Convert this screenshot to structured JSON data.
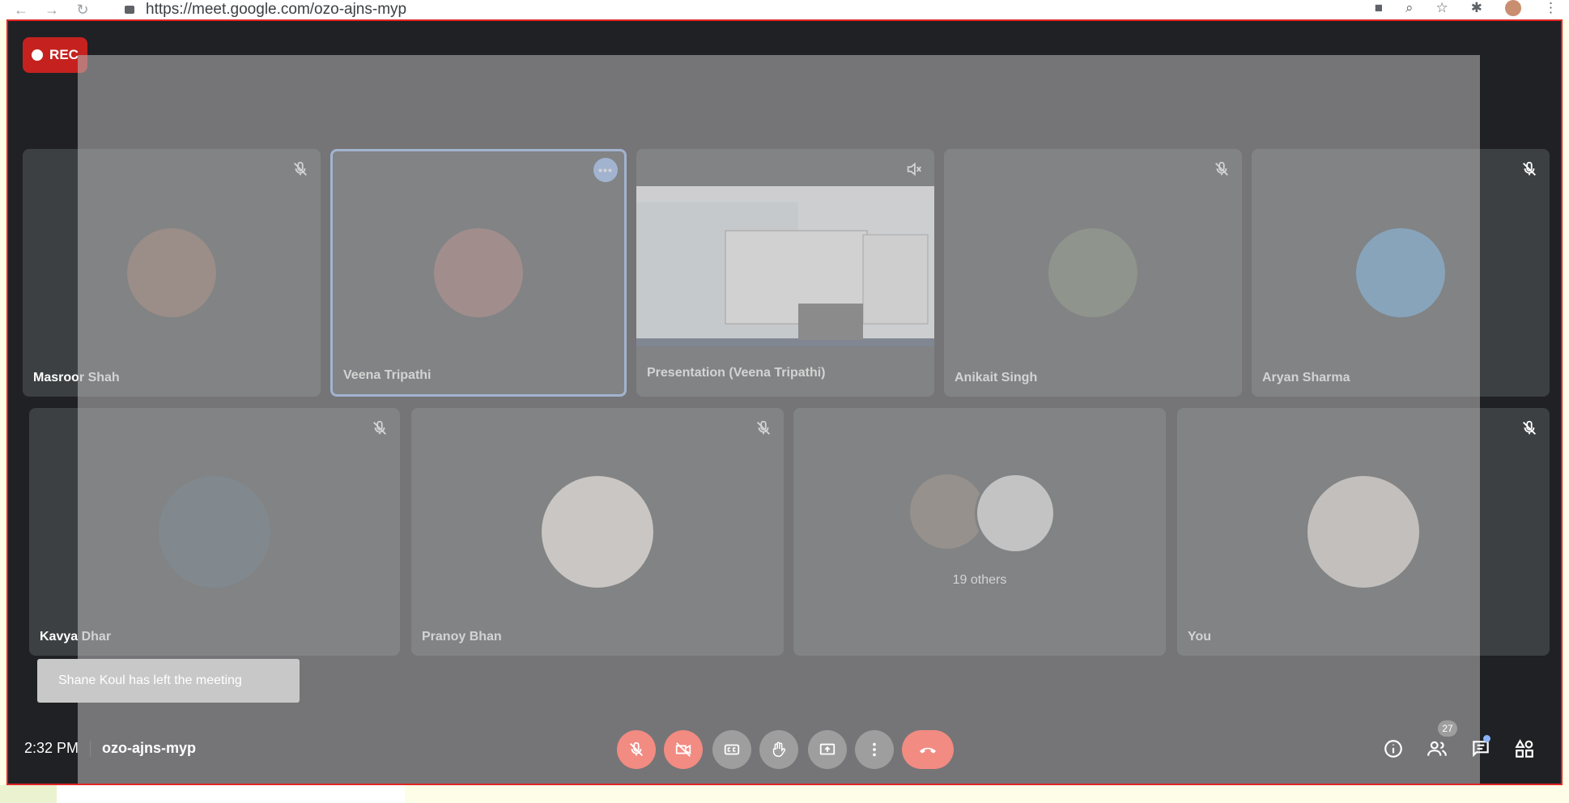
{
  "browser": {
    "url": "https://meet.google.com/ozo-ajns-myp"
  },
  "recording": {
    "label": "REC"
  },
  "tiles_row1": [
    {
      "name": "Masroor Shah",
      "muted": true,
      "avatar_color": "#7a5a4a"
    },
    {
      "name": "Veena Tripathi",
      "active": true,
      "avatar_color": "#8a5a5a"
    },
    {
      "name": "Presentation (Veena Tripathi)",
      "type": "presentation"
    },
    {
      "name": "Anikait Singh",
      "muted": true,
      "avatar_color": "#5e6a5a"
    },
    {
      "name": "Aryan Sharma",
      "muted": true,
      "avatar_color": "#4c8fc7"
    }
  ],
  "tiles_row2": [
    {
      "name": "Kavya Dhar",
      "muted": true,
      "avatar_color": "#3d4f5c"
    },
    {
      "name": "Pranoy Bhan",
      "muted": true,
      "avatar_color": "#e8e0d8"
    },
    {
      "label": "19 others"
    },
    {
      "name": "You",
      "muted": true,
      "avatar_color": "#d8cfc8"
    }
  ],
  "toast": {
    "text": "Shane Koul has left the meeting"
  },
  "footer": {
    "time": "2:32 PM",
    "meeting_code": "ozo-ajns-myp",
    "participant_count": "27"
  },
  "controls": [
    {
      "icon": "mic-off-icon"
    },
    {
      "icon": "camera-off-icon"
    },
    {
      "icon": "captions-icon"
    },
    {
      "icon": "raise-hand-icon"
    },
    {
      "icon": "present-screen-icon"
    },
    {
      "icon": "more-options-icon"
    },
    {
      "icon": "end-call-icon"
    }
  ],
  "right_icons": [
    "info-icon",
    "people-icon",
    "chat-icon",
    "activities-icon"
  ],
  "colors": {
    "meet_bg": "#202124",
    "tile_bg": "#3c4043",
    "active_border": "#8ab4f8",
    "rec_red": "#c5221f",
    "end_call": "#f28b82"
  }
}
